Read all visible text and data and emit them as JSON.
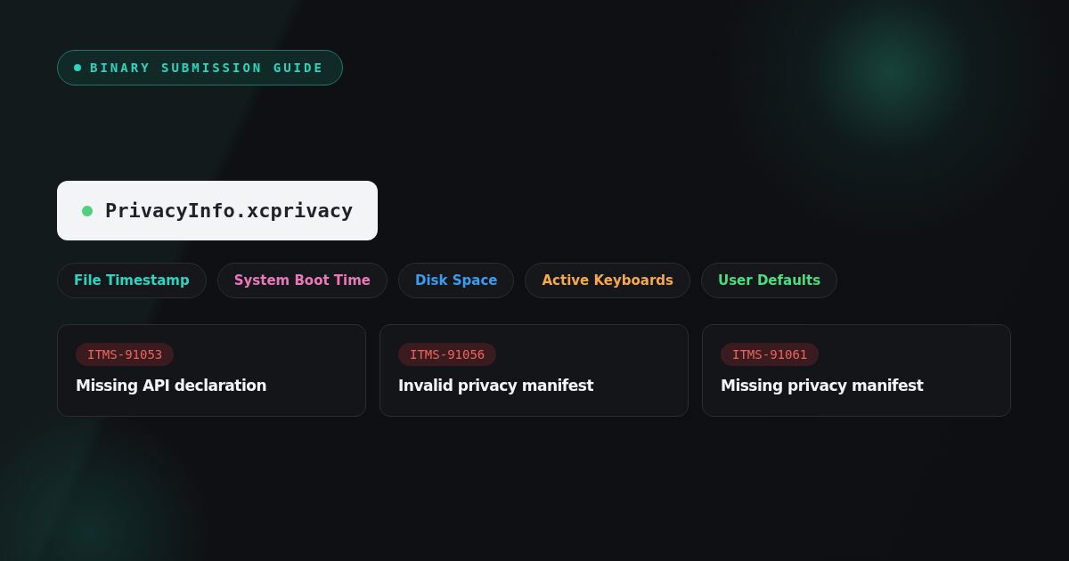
{
  "eyebrow": {
    "label": "BINARY SUBMISSION GUIDE"
  },
  "file": {
    "name": "PrivacyInfo.xcprivacy"
  },
  "tags": [
    {
      "label": "File Timestamp",
      "color": "#2dd4bf"
    },
    {
      "label": "System Boot Time",
      "color": "#e879b9"
    },
    {
      "label": "Disk Space",
      "color": "#3b9cf0"
    },
    {
      "label": "Active Keyboards",
      "color": "#f5a94a"
    },
    {
      "label": "User Defaults",
      "color": "#4ade80"
    }
  ],
  "errors": [
    {
      "code": "ITMS-91053",
      "title": "Missing API declaration"
    },
    {
      "code": "ITMS-91056",
      "title": "Invalid privacy manifest"
    },
    {
      "code": "ITMS-91061",
      "title": "Missing privacy manifest"
    }
  ]
}
